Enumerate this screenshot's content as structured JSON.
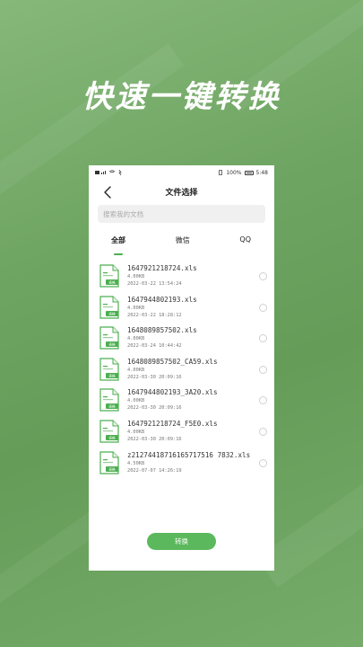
{
  "promo": {
    "headline": "快速一键转换"
  },
  "status_bar": {
    "battery": "100%",
    "time": "5:48"
  },
  "nav": {
    "title": "文件选择"
  },
  "search": {
    "placeholder": "搜索我的文档"
  },
  "tabs": [
    {
      "label": "全部",
      "active": true
    },
    {
      "label": "微信",
      "active": false
    },
    {
      "label": "QQ",
      "active": false
    }
  ],
  "file_badge": "表格",
  "files": [
    {
      "name": "1647921218724.xls",
      "size": "4.00KB",
      "date": "2022-03-22 13:54:24"
    },
    {
      "name": "1647944802193.xls",
      "size": "4.00KB",
      "date": "2022-03-22 18:28:12"
    },
    {
      "name": "1648089857502.xls",
      "size": "4.00KB",
      "date": "2022-03-24 10:44:42"
    },
    {
      "name": "1648089857502_CA59.xls",
      "size": "4.00KB",
      "date": "2022-03-30 20:09:16"
    },
    {
      "name": "1647944802193_3A20.xls",
      "size": "4.00KB",
      "date": "2022-03-30 20:09:16"
    },
    {
      "name": "1647921218724_F5E0.xls",
      "size": "4.00KB",
      "date": "2022-03-30 20:09:16"
    },
    {
      "name": "z21274418716165717516 7832.xls",
      "size": "4.50KB",
      "date": "2022-07-07 14:26:19"
    }
  ],
  "action": {
    "convert_label": "转换"
  },
  "colors": {
    "accent": "#5cb85c",
    "background": "#6fa563"
  }
}
